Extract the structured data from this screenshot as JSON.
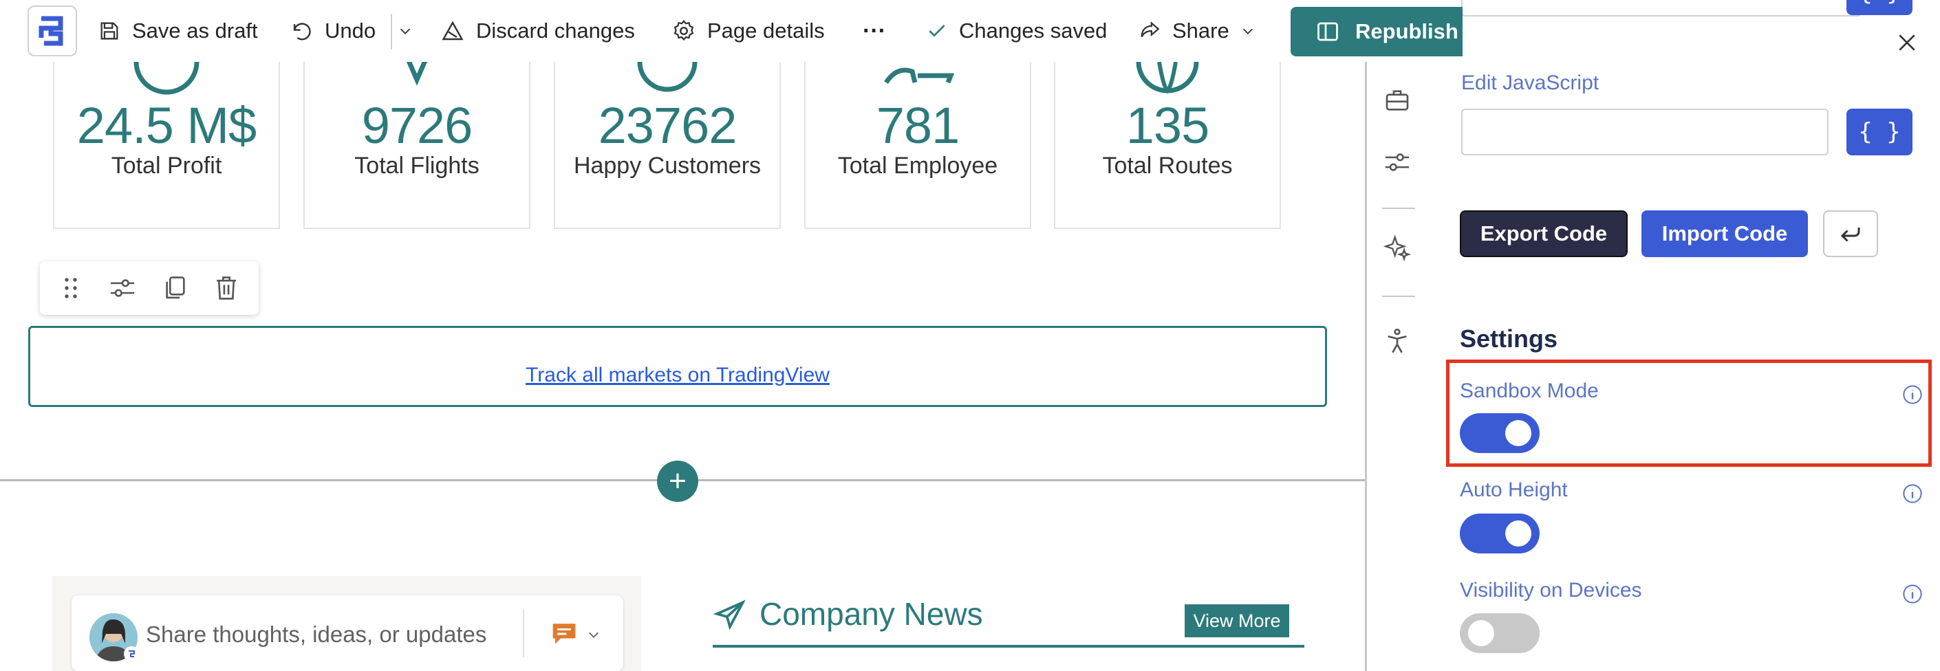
{
  "toolbar": {
    "save_draft": "Save as draft",
    "undo": "Undo",
    "discard": "Discard changes",
    "page_details": "Page details",
    "more": "···",
    "changes_saved": "Changes saved",
    "share": "Share",
    "republish": "Republish"
  },
  "stats": [
    {
      "value": "24.5 M$",
      "label": "Total Profit"
    },
    {
      "value": "9726",
      "label": "Total Flights"
    },
    {
      "value": "23762",
      "label": "Happy Customers"
    },
    {
      "value": "781",
      "label": "Total Employee"
    },
    {
      "value": "135",
      "label": "Total Routes"
    }
  ],
  "embed": {
    "link_text": "Track all markets on TradingView"
  },
  "post": {
    "placeholder": "Share thoughts, ideas, or updates"
  },
  "news": {
    "title": "Company News",
    "view_more": "View More"
  },
  "panel": {
    "code_btn": "{ }",
    "edit_js_label": "Edit JavaScript",
    "export_code": "Export Code",
    "import_code": "Import Code",
    "settings_heading": "Settings",
    "settings": [
      {
        "label": "Sandbox Mode",
        "on": true
      },
      {
        "label": "Auto Height",
        "on": true
      },
      {
        "label": "Visibility on Devices",
        "on": false
      }
    ]
  },
  "colors": {
    "teal": "#2c7a7b",
    "blue": "#3b5bd5",
    "dark": "#2a2d45",
    "highlight": "#e2351e"
  }
}
